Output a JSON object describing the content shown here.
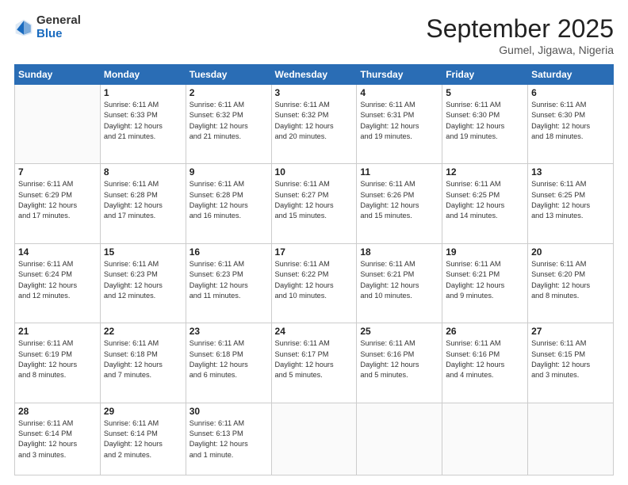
{
  "header": {
    "logo": {
      "line1": "General",
      "line2": "Blue"
    },
    "month": "September 2025",
    "location": "Gumel, Jigawa, Nigeria"
  },
  "weekdays": [
    "Sunday",
    "Monday",
    "Tuesday",
    "Wednesday",
    "Thursday",
    "Friday",
    "Saturday"
  ],
  "weeks": [
    [
      {
        "day": "",
        "info": ""
      },
      {
        "day": "1",
        "info": "Sunrise: 6:11 AM\nSunset: 6:33 PM\nDaylight: 12 hours\nand 21 minutes."
      },
      {
        "day": "2",
        "info": "Sunrise: 6:11 AM\nSunset: 6:32 PM\nDaylight: 12 hours\nand 21 minutes."
      },
      {
        "day": "3",
        "info": "Sunrise: 6:11 AM\nSunset: 6:32 PM\nDaylight: 12 hours\nand 20 minutes."
      },
      {
        "day": "4",
        "info": "Sunrise: 6:11 AM\nSunset: 6:31 PM\nDaylight: 12 hours\nand 19 minutes."
      },
      {
        "day": "5",
        "info": "Sunrise: 6:11 AM\nSunset: 6:30 PM\nDaylight: 12 hours\nand 19 minutes."
      },
      {
        "day": "6",
        "info": "Sunrise: 6:11 AM\nSunset: 6:30 PM\nDaylight: 12 hours\nand 18 minutes."
      }
    ],
    [
      {
        "day": "7",
        "info": "Sunrise: 6:11 AM\nSunset: 6:29 PM\nDaylight: 12 hours\nand 17 minutes."
      },
      {
        "day": "8",
        "info": "Sunrise: 6:11 AM\nSunset: 6:28 PM\nDaylight: 12 hours\nand 17 minutes."
      },
      {
        "day": "9",
        "info": "Sunrise: 6:11 AM\nSunset: 6:28 PM\nDaylight: 12 hours\nand 16 minutes."
      },
      {
        "day": "10",
        "info": "Sunrise: 6:11 AM\nSunset: 6:27 PM\nDaylight: 12 hours\nand 15 minutes."
      },
      {
        "day": "11",
        "info": "Sunrise: 6:11 AM\nSunset: 6:26 PM\nDaylight: 12 hours\nand 15 minutes."
      },
      {
        "day": "12",
        "info": "Sunrise: 6:11 AM\nSunset: 6:25 PM\nDaylight: 12 hours\nand 14 minutes."
      },
      {
        "day": "13",
        "info": "Sunrise: 6:11 AM\nSunset: 6:25 PM\nDaylight: 12 hours\nand 13 minutes."
      }
    ],
    [
      {
        "day": "14",
        "info": "Sunrise: 6:11 AM\nSunset: 6:24 PM\nDaylight: 12 hours\nand 12 minutes."
      },
      {
        "day": "15",
        "info": "Sunrise: 6:11 AM\nSunset: 6:23 PM\nDaylight: 12 hours\nand 12 minutes."
      },
      {
        "day": "16",
        "info": "Sunrise: 6:11 AM\nSunset: 6:23 PM\nDaylight: 12 hours\nand 11 minutes."
      },
      {
        "day": "17",
        "info": "Sunrise: 6:11 AM\nSunset: 6:22 PM\nDaylight: 12 hours\nand 10 minutes."
      },
      {
        "day": "18",
        "info": "Sunrise: 6:11 AM\nSunset: 6:21 PM\nDaylight: 12 hours\nand 10 minutes."
      },
      {
        "day": "19",
        "info": "Sunrise: 6:11 AM\nSunset: 6:21 PM\nDaylight: 12 hours\nand 9 minutes."
      },
      {
        "day": "20",
        "info": "Sunrise: 6:11 AM\nSunset: 6:20 PM\nDaylight: 12 hours\nand 8 minutes."
      }
    ],
    [
      {
        "day": "21",
        "info": "Sunrise: 6:11 AM\nSunset: 6:19 PM\nDaylight: 12 hours\nand 8 minutes."
      },
      {
        "day": "22",
        "info": "Sunrise: 6:11 AM\nSunset: 6:18 PM\nDaylight: 12 hours\nand 7 minutes."
      },
      {
        "day": "23",
        "info": "Sunrise: 6:11 AM\nSunset: 6:18 PM\nDaylight: 12 hours\nand 6 minutes."
      },
      {
        "day": "24",
        "info": "Sunrise: 6:11 AM\nSunset: 6:17 PM\nDaylight: 12 hours\nand 5 minutes."
      },
      {
        "day": "25",
        "info": "Sunrise: 6:11 AM\nSunset: 6:16 PM\nDaylight: 12 hours\nand 5 minutes."
      },
      {
        "day": "26",
        "info": "Sunrise: 6:11 AM\nSunset: 6:16 PM\nDaylight: 12 hours\nand 4 minutes."
      },
      {
        "day": "27",
        "info": "Sunrise: 6:11 AM\nSunset: 6:15 PM\nDaylight: 12 hours\nand 3 minutes."
      }
    ],
    [
      {
        "day": "28",
        "info": "Sunrise: 6:11 AM\nSunset: 6:14 PM\nDaylight: 12 hours\nand 3 minutes."
      },
      {
        "day": "29",
        "info": "Sunrise: 6:11 AM\nSunset: 6:14 PM\nDaylight: 12 hours\nand 2 minutes."
      },
      {
        "day": "30",
        "info": "Sunrise: 6:11 AM\nSunset: 6:13 PM\nDaylight: 12 hours\nand 1 minute."
      },
      {
        "day": "",
        "info": ""
      },
      {
        "day": "",
        "info": ""
      },
      {
        "day": "",
        "info": ""
      },
      {
        "day": "",
        "info": ""
      }
    ]
  ]
}
